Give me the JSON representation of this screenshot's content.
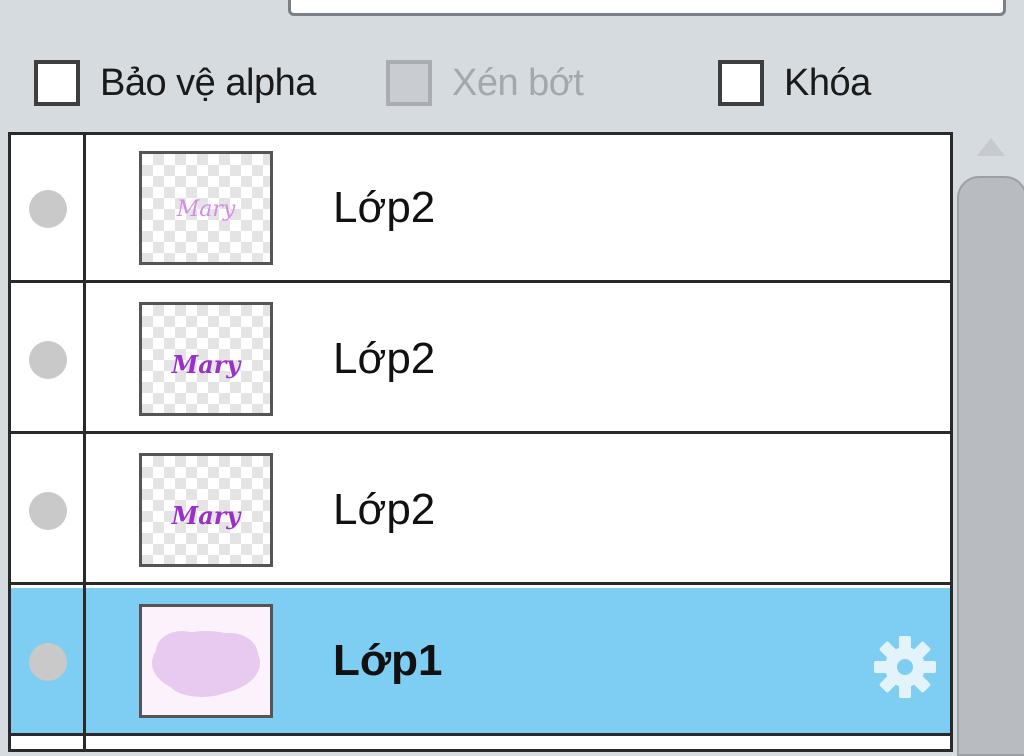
{
  "options": {
    "protect_alpha": {
      "label": "Bảo vệ alpha",
      "checked": false
    },
    "clip": {
      "label": "Xén bớt",
      "checked": false,
      "disabled": true
    },
    "lock": {
      "label": "Khóa",
      "checked": false
    }
  },
  "layers": [
    {
      "name": "Lớp2",
      "selected": false,
      "thumb_text": "Mary",
      "thumb_color": "#d58be8"
    },
    {
      "name": "Lớp2",
      "selected": false,
      "thumb_text": "Mary",
      "thumb_color": "#9b2fc9"
    },
    {
      "name": "Lớp2",
      "selected": false,
      "thumb_text": "Mary",
      "thumb_color": "#9b2fc9"
    },
    {
      "name": "Lớp1",
      "selected": true,
      "thumb_color": "#e8c9f0"
    }
  ],
  "colors": {
    "selection": "#7ecdf3",
    "panel_bg": "#d6dbe0"
  }
}
